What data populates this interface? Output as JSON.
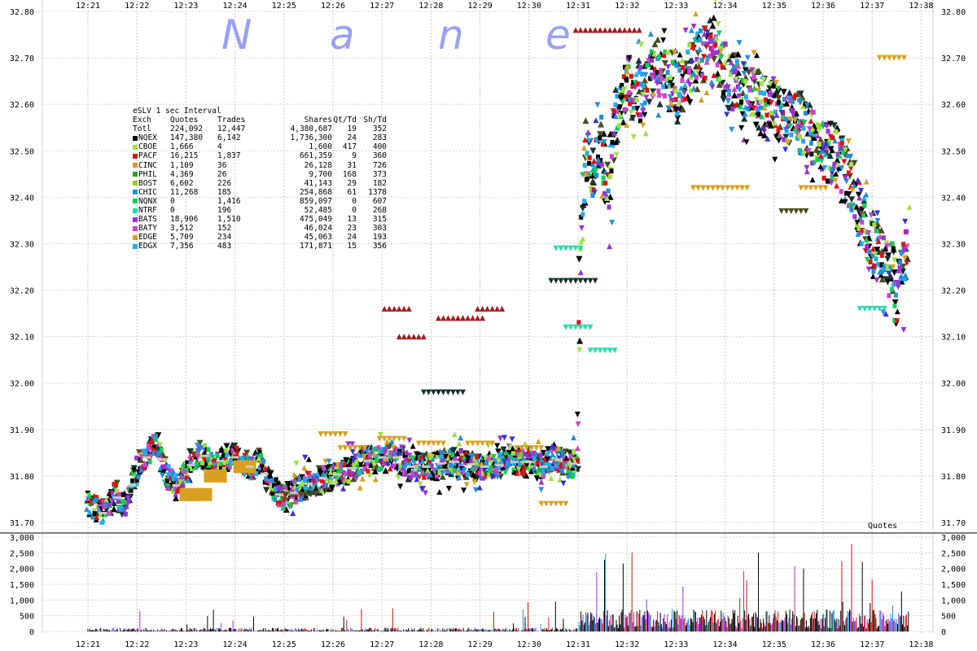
{
  "watermark": [
    "N",
    "a",
    "n",
    "e"
  ],
  "chart_data": [
    {
      "type": "scatter",
      "title": "eSLV 1 sec Interval",
      "x_ticks": [
        "12:21",
        "12:22",
        "12:23",
        "12:24",
        "12:25",
        "12:26",
        "12:27",
        "12:28",
        "12:29",
        "12:30",
        "12:31",
        "12:32",
        "12:33",
        "12:34",
        "12:35",
        "12:36",
        "12:37",
        "12:38"
      ],
      "y_ticks": [
        "32.80",
        "32.70",
        "32.60",
        "32.50",
        "32.40",
        "32.30",
        "32.20",
        "32.10",
        "32.00",
        "31.90",
        "31.80",
        "31.70"
      ],
      "ylim": [
        31.7,
        32.8
      ],
      "grid": true,
      "series_colors": {
        "NQEX": "#000000",
        "PACF": "#dd1111",
        "CHIC": "#1e90d8",
        "BATS": "#9b30d8",
        "BATY": "#cc44cc",
        "EDGE": "#d8a020",
        "EDGX": "#22aaee",
        "CBOE": "#a0e040",
        "BOST": "#96d010",
        "NQNX": "#11cc55",
        "NTRF": "#22ddaa",
        "CINC": "#e89030",
        "PHIL": "#22aa22",
        "olive": "#4b4b20",
        "darkteal": "#143232",
        "darkred": "#a81818",
        "blue": "#3333cc"
      },
      "price_path": [
        [
          0,
          31.74
        ],
        [
          0.3,
          31.72
        ],
        [
          0.5,
          31.76
        ],
        [
          0.8,
          31.74
        ],
        [
          1.0,
          31.82
        ],
        [
          1.2,
          31.84
        ],
        [
          1.4,
          31.87
        ],
        [
          1.6,
          31.8
        ],
        [
          1.8,
          31.78
        ],
        [
          2.0,
          31.81
        ],
        [
          2.3,
          31.85
        ],
        [
          2.6,
          31.83
        ],
        [
          3.0,
          31.84
        ],
        [
          3.3,
          31.82
        ],
        [
          3.5,
          31.83
        ],
        [
          3.7,
          31.78
        ],
        [
          4.0,
          31.75
        ],
        [
          4.3,
          31.77
        ],
        [
          4.6,
          31.79
        ],
        [
          5.0,
          31.8
        ],
        [
          5.3,
          31.81
        ],
        [
          5.6,
          31.83
        ],
        [
          6.0,
          31.84
        ],
        [
          6.3,
          31.84
        ],
        [
          6.6,
          31.82
        ],
        [
          7.0,
          31.82
        ],
        [
          7.3,
          31.83
        ],
        [
          7.6,
          31.83
        ],
        [
          8.0,
          31.82
        ],
        [
          8.3,
          31.82
        ],
        [
          8.6,
          31.83
        ],
        [
          9.0,
          31.83
        ],
        [
          9.3,
          31.82
        ],
        [
          9.5,
          31.84
        ],
        [
          9.7,
          31.83
        ],
        [
          9.85,
          31.82
        ],
        [
          10.0,
          31.84
        ],
        [
          10.05,
          32.3
        ],
        [
          10.15,
          32.5
        ],
        [
          10.3,
          32.45
        ],
        [
          10.45,
          32.55
        ],
        [
          10.6,
          32.4
        ],
        [
          10.8,
          32.6
        ],
        [
          11.0,
          32.65
        ],
        [
          11.3,
          32.62
        ],
        [
          11.6,
          32.68
        ],
        [
          12.0,
          32.63
        ],
        [
          12.4,
          32.7
        ],
        [
          12.8,
          32.72
        ],
        [
          13.1,
          32.65
        ],
        [
          13.4,
          32.63
        ],
        [
          13.8,
          32.6
        ],
        [
          14.2,
          32.58
        ],
        [
          14.6,
          32.55
        ],
        [
          15.0,
          32.5
        ],
        [
          15.3,
          32.48
        ],
        [
          15.6,
          32.42
        ],
        [
          15.8,
          32.35
        ],
        [
          16.0,
          32.3
        ],
        [
          16.2,
          32.26
        ],
        [
          16.4,
          32.24
        ],
        [
          16.5,
          32.18
        ],
        [
          16.6,
          32.22
        ],
        [
          16.75,
          32.33
        ]
      ],
      "price_marks": {
        "NTRF": [
          [
            9.8,
            32.29
          ],
          [
            10.0,
            32.12
          ],
          [
            10.5,
            32.07
          ],
          [
            16.0,
            32.16
          ]
        ],
        "EDGE": [
          [
            5.0,
            31.89
          ],
          [
            5.4,
            31.86
          ],
          [
            6.2,
            31.88
          ],
          [
            7.0,
            31.87
          ],
          [
            8.0,
            31.87
          ],
          [
            9.0,
            31.86
          ],
          [
            9.5,
            31.74
          ],
          [
            12.6,
            32.42
          ],
          [
            13.2,
            32.42
          ],
          [
            14.8,
            32.42
          ],
          [
            16.4,
            32.7
          ]
        ],
        "darkred": [
          [
            10.2,
            32.76
          ],
          [
            10.6,
            32.76
          ],
          [
            11.0,
            32.76
          ],
          [
            6.3,
            32.16
          ],
          [
            6.6,
            32.1
          ],
          [
            7.4,
            32.14
          ],
          [
            7.8,
            32.14
          ],
          [
            8.2,
            32.16
          ]
        ],
        "darkteal": [
          [
            7.1,
            31.98
          ],
          [
            7.4,
            31.98
          ],
          [
            9.7,
            32.22
          ],
          [
            10.1,
            32.22
          ]
        ],
        "olive": [
          [
            4.1,
            31.76
          ],
          [
            4.4,
            31.76
          ],
          [
            14.4,
            32.37
          ]
        ]
      },
      "volume_panel": {
        "y_ticks": [
          "3,000",
          "2,500",
          "2,000",
          "1,500",
          "1,000",
          "500",
          "0"
        ],
        "ylim": [
          0,
          3000
        ],
        "label": "Quotes"
      },
      "stats_table": {
        "title": "eSLV 1 sec Interval",
        "headers": [
          "Exch",
          "Quotes",
          "Trades",
          "Shares",
          "Qt/Td",
          "Sh/Td"
        ],
        "rows": [
          {
            "exch": "Totl",
            "quotes": "224,092",
            "trades": "12,447",
            "shares": "4,380,687",
            "qt_td": "19",
            "sh_td": "352",
            "color": ""
          },
          {
            "exch": "NQEX",
            "quotes": "147,380",
            "trades": "6,142",
            "shares": "1,736,300",
            "qt_td": "24",
            "sh_td": "283",
            "color": "#000000"
          },
          {
            "exch": "CBOE",
            "quotes": "1,666",
            "trades": "4",
            "shares": "1,600",
            "qt_td": "417",
            "sh_td": "400",
            "color": "#a0e040"
          },
          {
            "exch": "PACF",
            "quotes": "16,215",
            "trades": "1,837",
            "shares": "661,359",
            "qt_td": "9",
            "sh_td": "360",
            "color": "#dd1111"
          },
          {
            "exch": "CINC",
            "quotes": "1,109",
            "trades": "36",
            "shares": "26,128",
            "qt_td": "31",
            "sh_td": "726",
            "color": "#e89030"
          },
          {
            "exch": "PHIL",
            "quotes": "4,369",
            "trades": "26",
            "shares": "9,700",
            "qt_td": "168",
            "sh_td": "373",
            "color": "#22aa22"
          },
          {
            "exch": "BOST",
            "quotes": "6,602",
            "trades": "226",
            "shares": "41,143",
            "qt_td": "29",
            "sh_td": "182",
            "color": "#96d010"
          },
          {
            "exch": "CHIC",
            "quotes": "11,268",
            "trades": "185",
            "shares": "254,868",
            "qt_td": "61",
            "sh_td": "1378",
            "color": "#1e90d8"
          },
          {
            "exch": "NQNX",
            "quotes": "0",
            "trades": "1,416",
            "shares": "859,097",
            "qt_td": "0",
            "sh_td": "607",
            "color": "#11cc55"
          },
          {
            "exch": "NTRF",
            "quotes": "0",
            "trades": "196",
            "shares": "52,485",
            "qt_td": "0",
            "sh_td": "268",
            "color": "#22ddaa"
          },
          {
            "exch": "BATS",
            "quotes": "18,906",
            "trades": "1,510",
            "shares": "475,049",
            "qt_td": "13",
            "sh_td": "315",
            "color": "#9b30d8"
          },
          {
            "exch": "BATY",
            "quotes": "3,512",
            "trades": "152",
            "shares": "46,024",
            "qt_td": "23",
            "sh_td": "303",
            "color": "#cc44cc"
          },
          {
            "exch": "EDGE",
            "quotes": "5,709",
            "trades": "234",
            "shares": "45,063",
            "qt_td": "24",
            "sh_td": "193",
            "color": "#d8a020"
          },
          {
            "exch": "EDGX",
            "quotes": "7,356",
            "trades": "483",
            "shares": "171,871",
            "qt_td": "15",
            "sh_td": "356",
            "color": "#22aaee"
          }
        ]
      }
    }
  ]
}
